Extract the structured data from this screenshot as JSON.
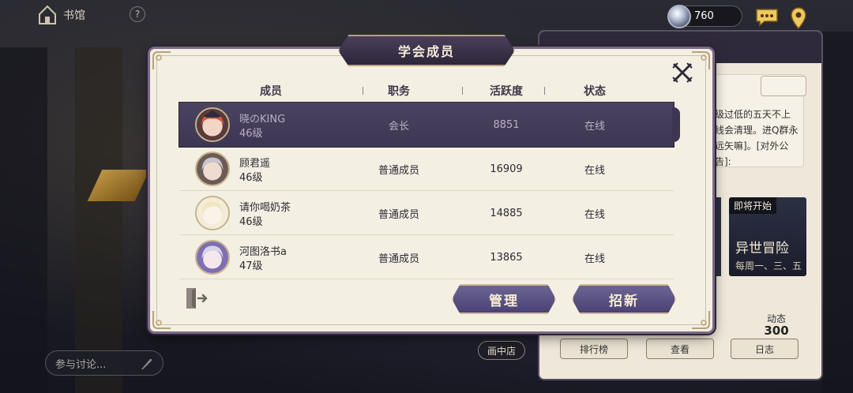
{
  "top_bar": {
    "title": "书馆",
    "help": "?",
    "currency_value": "760"
  },
  "background_panel": {
    "notice_text": "级过低的五天不上线会清理。进Q群永远矢嘛]。[对外公告]:",
    "event_tag": "即将开始",
    "event_title": "异世冒险",
    "event_subtitle": "每周一、三、五",
    "stat_label": "动态",
    "stat_value": "300",
    "buttons": [
      "排行榜",
      "查看",
      "日志"
    ]
  },
  "shop_badge": "画中店",
  "discuss_placeholder": "参与讨论...",
  "dialog": {
    "title": "学会成员",
    "columns": [
      "成员",
      "职务",
      "活跃度",
      "状态"
    ],
    "members": [
      {
        "name": "晓のKING",
        "level": "46级",
        "role": "会长",
        "activity": "8851",
        "status": "在线",
        "selected": true
      },
      {
        "name": "顾君遥",
        "level": "46级",
        "role": "普通成员",
        "activity": "16909",
        "status": "在线",
        "selected": false
      },
      {
        "name": "请你喝奶茶",
        "level": "46级",
        "role": "普通成员",
        "activity": "14885",
        "status": "在线",
        "selected": false
      },
      {
        "name": "河图洛书a",
        "level": "47级",
        "role": "普通成员",
        "activity": "13865",
        "status": "在线",
        "selected": false
      }
    ],
    "manage_label": "管理",
    "recruit_label": "招新"
  },
  "colors": {
    "selected_row": "#433c58",
    "button_purple": "#5d5584",
    "gold_trim": "#cdbb8e",
    "parchment": "#f4efe3"
  }
}
